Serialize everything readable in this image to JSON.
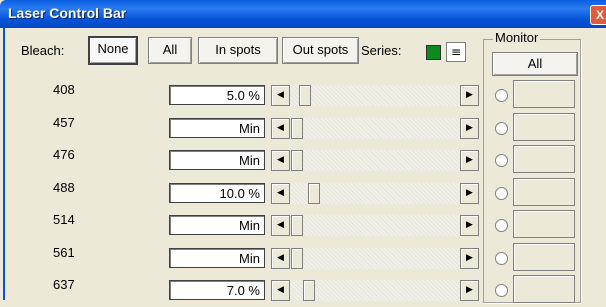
{
  "window": {
    "title": "Laser Control Bar",
    "close_label": "X"
  },
  "bleach": {
    "label": "Bleach:",
    "buttons": [
      {
        "label": "None",
        "selected": true
      },
      {
        "label": "All"
      },
      {
        "label": "In spots"
      },
      {
        "label": "Out spots"
      }
    ]
  },
  "series": {
    "label": "Series:",
    "swatch_color": "#0b8a1e",
    "menu_icon": "list-icon",
    "menu_glyph": "≡"
  },
  "lasers": [
    {
      "wavelength": "408",
      "value": "5.0 %",
      "slider_level": 0.05
    },
    {
      "wavelength": "457",
      "value": "Min",
      "slider_level": 0.0
    },
    {
      "wavelength": "476",
      "value": "Min",
      "slider_level": 0.0
    },
    {
      "wavelength": "488",
      "value": "10.0 %",
      "slider_level": 0.1
    },
    {
      "wavelength": "514",
      "value": "Min",
      "slider_level": 0.0
    },
    {
      "wavelength": "561",
      "value": "Min",
      "slider_level": 0.0
    },
    {
      "wavelength": "637",
      "value": "7.0 %",
      "slider_level": 0.07
    }
  ],
  "monitor": {
    "label": "Monitor",
    "all_label": "All"
  },
  "glyphs": {
    "left_arrow": "◀",
    "right_arrow": "▶"
  }
}
